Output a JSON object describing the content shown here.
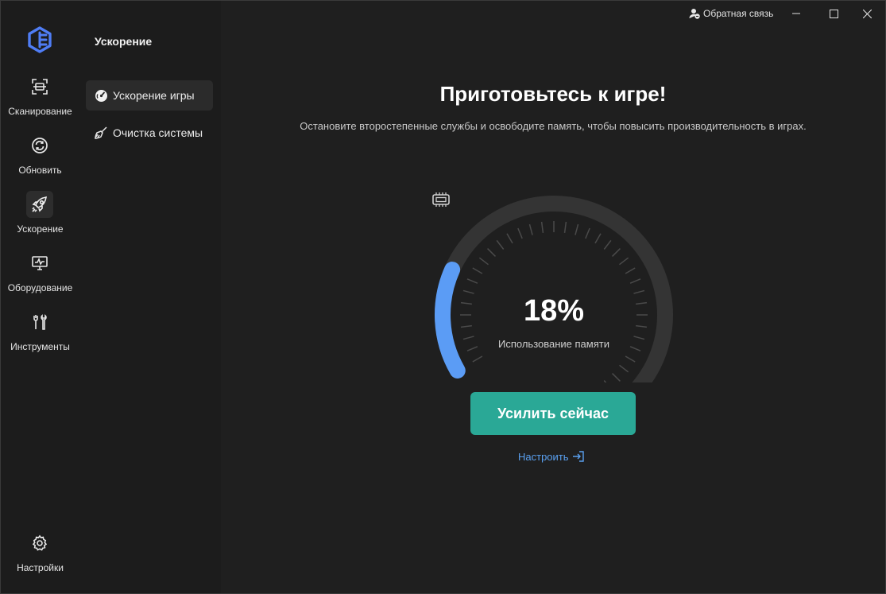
{
  "app": {
    "section_title": "Ускорение",
    "feedback_label": "Обратная связь"
  },
  "rail": {
    "items": [
      {
        "label": "Сканирование",
        "icon": "scan-icon"
      },
      {
        "label": "Обновить",
        "icon": "refresh-icon"
      },
      {
        "label": "Ускорение",
        "icon": "rocket-icon",
        "active": true
      },
      {
        "label": "Оборудование",
        "icon": "hardware-monitor-icon"
      },
      {
        "label": "Инструменты",
        "icon": "tools-icon"
      }
    ],
    "settings_label": "Настройки"
  },
  "subnav": {
    "items": [
      {
        "label": "Ускорение игры",
        "icon": "speedometer-icon",
        "active": true
      },
      {
        "label": "Очистка системы",
        "icon": "broom-icon"
      }
    ]
  },
  "main": {
    "headline": "Приготовьтесь к игре!",
    "subline": "Остановите второстепенные службы и освободите память, чтобы повысить производительность в играх.",
    "gauge": {
      "value_text": "18%",
      "value_fraction": 0.18,
      "label": "Использование памяти"
    },
    "boost_button": "Усилить сейчас",
    "configure_link": "Настроить"
  },
  "colors": {
    "accent_button": "#2aa896",
    "gauge_fill": "#5b9cf5",
    "gauge_track": "#343434",
    "link": "#5aa0f0",
    "logo": "#4f7df5"
  }
}
